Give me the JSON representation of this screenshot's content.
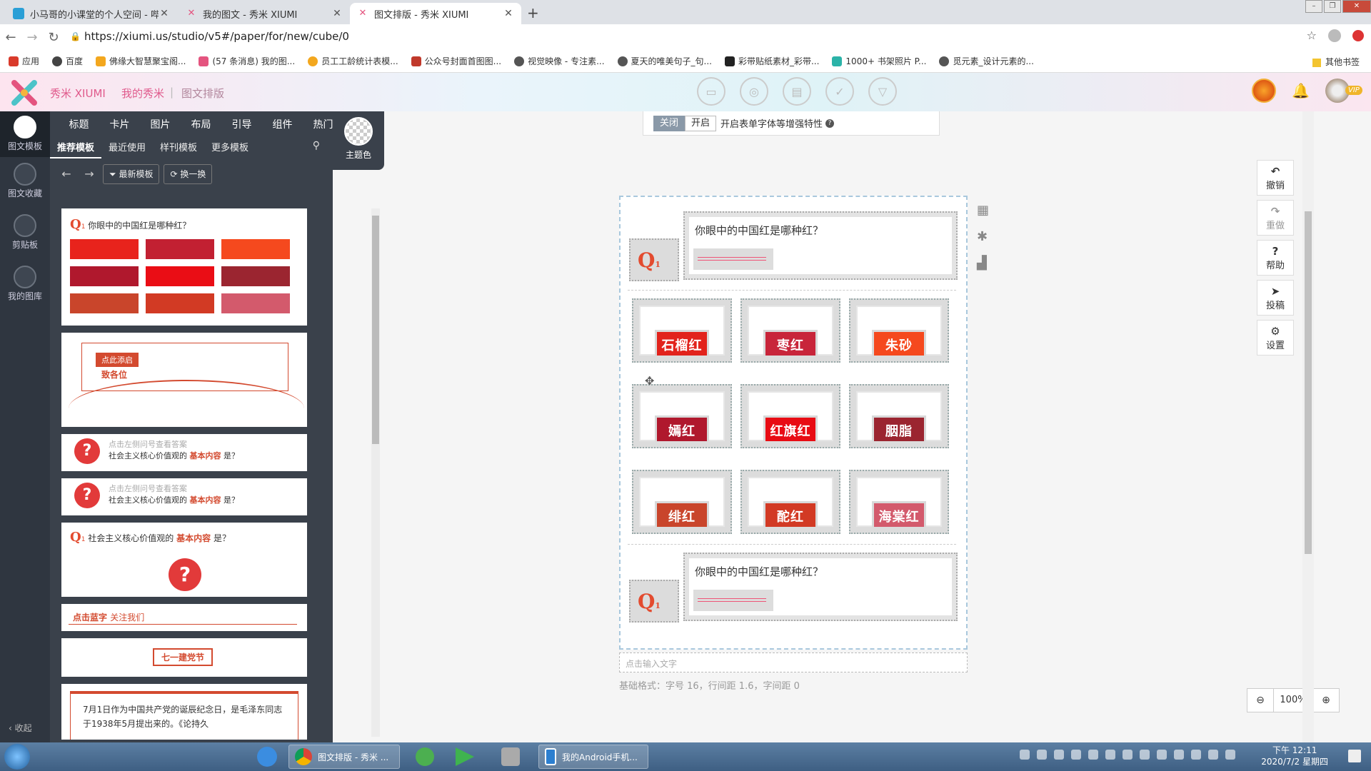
{
  "tabs": [
    {
      "title": "小马哥的小课堂的个人空间 - 哔哩",
      "active": false
    },
    {
      "title": "我的图文 - 秀米 XIUMI",
      "active": false
    },
    {
      "title": "图文排版 - 秀米 XIUMI",
      "active": true
    }
  ],
  "address": {
    "url": "https://xiumi.us/studio/v5#/paper/for/new/cube/0"
  },
  "bookmarks": [
    "应用",
    "百度",
    "佛缘大智慧聚宝阁...",
    "(57 条消息) 我的图...",
    "员工工龄统计表模...",
    "公众号封面首图图...",
    "视觉映像 - 专注素...",
    "夏天的唯美句子_句...",
    "彩带贴纸素材_彩带...",
    "1000+ 书架照片 P...",
    "觅元素_设计元素的..."
  ],
  "bookmarks_other": "其他书签",
  "app": {
    "brand": "秀米 XIUMI",
    "crumb1": "我的秀米",
    "crumb2": "图文排版",
    "vip": "VIP"
  },
  "sidebar": [
    {
      "label": "图文模板"
    },
    {
      "label": "图文收藏"
    },
    {
      "label": "剪贴板"
    },
    {
      "label": "我的图库"
    }
  ],
  "collapse": "收起",
  "panel": {
    "categories": [
      "标题",
      "卡片",
      "图片",
      "布局",
      "引导",
      "组件",
      "热门"
    ],
    "subtabs": [
      "推荐模板",
      "最近使用",
      "样刊模板",
      "更多模板"
    ],
    "newest": "最新模板",
    "swap": "换一换",
    "theme": "主题色"
  },
  "templates": {
    "t1_q": "你眼中的中国红是哪种红？",
    "t1_colors": [
      "#e8231c",
      "#c22032",
      "#f5491e",
      "#b0182d",
      "#ea0d15",
      "#9b2530",
      "#c9452b",
      "#d23a24",
      "#d35a6c"
    ],
    "t2_tag": "点此添启",
    "t2_text": "致各位",
    "t3_hint": "点击左侧问号查看答案",
    "t3_q1": "社会主义核心价值观的",
    "t3_q2": "基本内容",
    "t3_q3": "是？",
    "t5_q": "社会主义核心价值观的",
    "t5_hl": "基本内容",
    "t5_end": "是？",
    "t6_a": "点击蓝字",
    "t6_b": "关注我们",
    "t7": "七一建党节",
    "t8": "7月1日作为中国共产党的诞辰纪念日，是毛泽东同志于1938年5月提出来的。《论持久"
  },
  "editor": {
    "close": "关闭",
    "open": "开启",
    "tip": "开启表单字体等增强特性",
    "question": "你眼中的中国红是哪种红？",
    "colors": [
      {
        "name": "石榴红",
        "hex": "#e2231c"
      },
      {
        "name": "枣红",
        "hex": "#c8253a"
      },
      {
        "name": "朱砂",
        "hex": "#f5491e"
      },
      {
        "name": "嫣红",
        "hex": "#b0182d"
      },
      {
        "name": "红旗红",
        "hex": "#e80c14"
      },
      {
        "name": "胭脂",
        "hex": "#9b2530"
      },
      {
        "name": "绯红",
        "hex": "#c9452b"
      },
      {
        "name": "酡红",
        "hex": "#d23a24"
      },
      {
        "name": "海棠红",
        "hex": "#d35a6c"
      }
    ],
    "input_placeholder": "点击输入文字",
    "format": "基础格式：字号 16，行间距 1.6，字间距 0"
  },
  "right_tools": [
    {
      "icon": "undo-icon",
      "label": "撤销"
    },
    {
      "icon": "redo-icon",
      "label": "重做"
    },
    {
      "icon": "help-icon",
      "label": "帮助"
    },
    {
      "icon": "send-icon",
      "label": "投稿"
    },
    {
      "icon": "gear-icon",
      "label": "设置"
    }
  ],
  "zoom": {
    "value": "100%"
  },
  "taskbar": {
    "chrome": "图文排版 - 秀米 ...",
    "android": "我的Android手机...",
    "time": "下午 12:11",
    "date": "2020/7/2 星期四"
  }
}
